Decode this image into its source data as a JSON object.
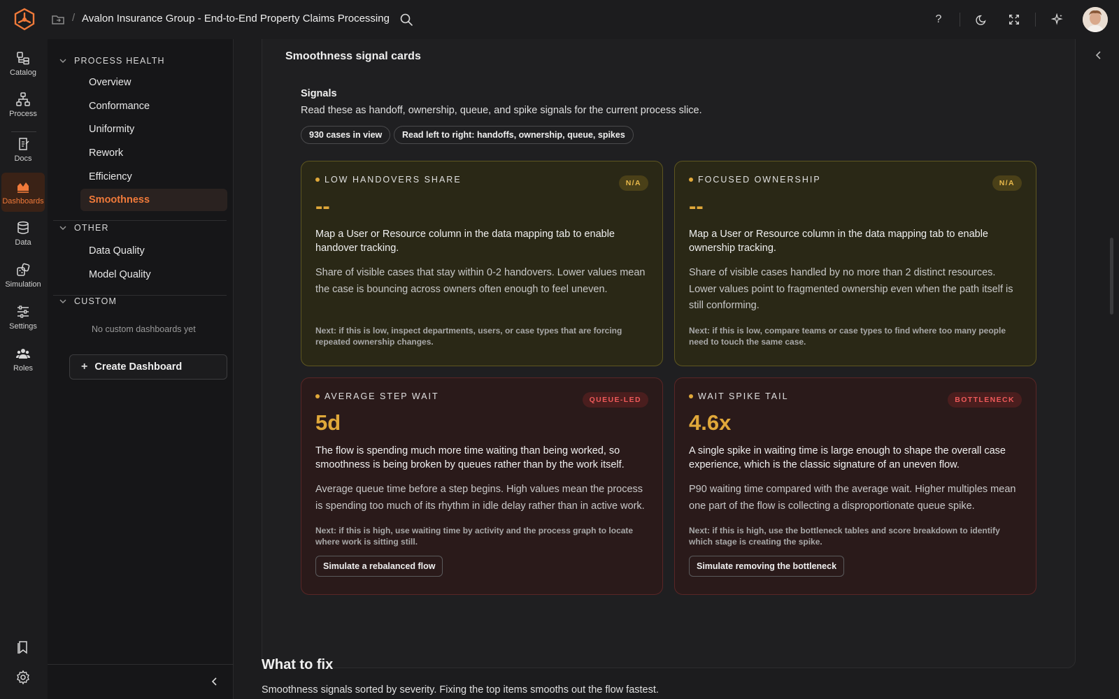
{
  "topbar": {
    "breadcrumb_sep": "/",
    "title": "Avalon Insurance Group - End-to-End Property Claims Processing",
    "help_label": "?"
  },
  "rail": {
    "items": [
      {
        "label": "Catalog",
        "icon": "catalog-icon"
      },
      {
        "label": "Process",
        "icon": "process-icon"
      },
      {
        "label": "Docs",
        "icon": "docs-icon"
      },
      {
        "label": "Dashboards",
        "icon": "dashboards-icon"
      },
      {
        "label": "Data",
        "icon": "database-icon"
      },
      {
        "label": "Simulation",
        "icon": "simulation-icon"
      },
      {
        "label": "Settings",
        "icon": "sliders-icon"
      },
      {
        "label": "Roles",
        "icon": "roles-icon"
      }
    ],
    "active": "Dashboards"
  },
  "nav": {
    "sections": [
      {
        "title": "PROCESS HEALTH",
        "items": [
          "Overview",
          "Conformance",
          "Uniformity",
          "Rework",
          "Efficiency",
          "Smoothness"
        ]
      },
      {
        "title": "OTHER",
        "items": [
          "Data Quality",
          "Model Quality"
        ]
      },
      {
        "title": "CUSTOM",
        "items": []
      }
    ],
    "active_item": "Smoothness",
    "custom_empty": "No custom dashboards yet",
    "create_button": "Create Dashboard"
  },
  "main": {
    "section_title": "Smoothness signal cards",
    "signals_heading": "Signals",
    "signals_sub": "Read these as handoff, ownership, queue, and spike signals for the current process slice.",
    "chips": [
      "930 cases in view",
      "Read left to right: handoffs, ownership, queue, spikes"
    ],
    "cards": [
      {
        "label": "LOW HANDOVERS SHARE",
        "badge": "N/A",
        "value": "--",
        "main": "Map a User or Resource column in the data mapping tab to enable handover tracking.",
        "desc": "Share of visible cases that stay within 0-2 handovers. Lower values mean the case is bouncing across owners often enough to feel uneven.",
        "next": "Next: if this is low, inspect departments, users, or case types that are forcing repeated ownership changes.",
        "button": ""
      },
      {
        "label": "FOCUSED OWNERSHIP",
        "badge": "N/A",
        "value": "--",
        "main": "Map a User or Resource column in the data mapping tab to enable ownership tracking.",
        "desc": "Share of visible cases handled by no more than 2 distinct resources. Lower values point to fragmented ownership even when the path itself is still conforming.",
        "next": "Next: if this is low, compare teams or case types to find where too many people need to touch the same case.",
        "button": ""
      },
      {
        "label": "AVERAGE STEP WAIT",
        "badge": "QUEUE-LED",
        "value": "5d",
        "main": "The flow is spending much more time waiting than being worked, so smoothness is being broken by queues rather than by the work itself.",
        "desc": "Average queue time before a step begins. High values mean the process is spending too much of its rhythm in idle delay rather than in active work.",
        "next": "Next: if this is high, use waiting time by activity and the process graph to locate where work is sitting still.",
        "button": "Simulate a rebalanced flow"
      },
      {
        "label": "WAIT SPIKE TAIL",
        "badge": "BOTTLENECK",
        "value": "4.6x",
        "main": "A single spike in waiting time is large enough to shape the overall case experience, which is the classic signature of an uneven flow.",
        "desc": "P90 waiting time compared with the average wait. Higher multiples mean one part of the flow is collecting a disproportionate queue spike.",
        "next": "Next: if this is high, use the bottleneck tables and score breakdown to identify which stage is creating the spike.",
        "button": "Simulate removing the bottleneck"
      }
    ],
    "fix_title": "What to fix",
    "fix_sub": "Smoothness signals sorted by severity. Fixing the top items smooths out the flow fastest."
  },
  "colors": {
    "accent": "#f07a3a",
    "warn_value": "#e0a83a",
    "danger": "#ef5a5a"
  }
}
